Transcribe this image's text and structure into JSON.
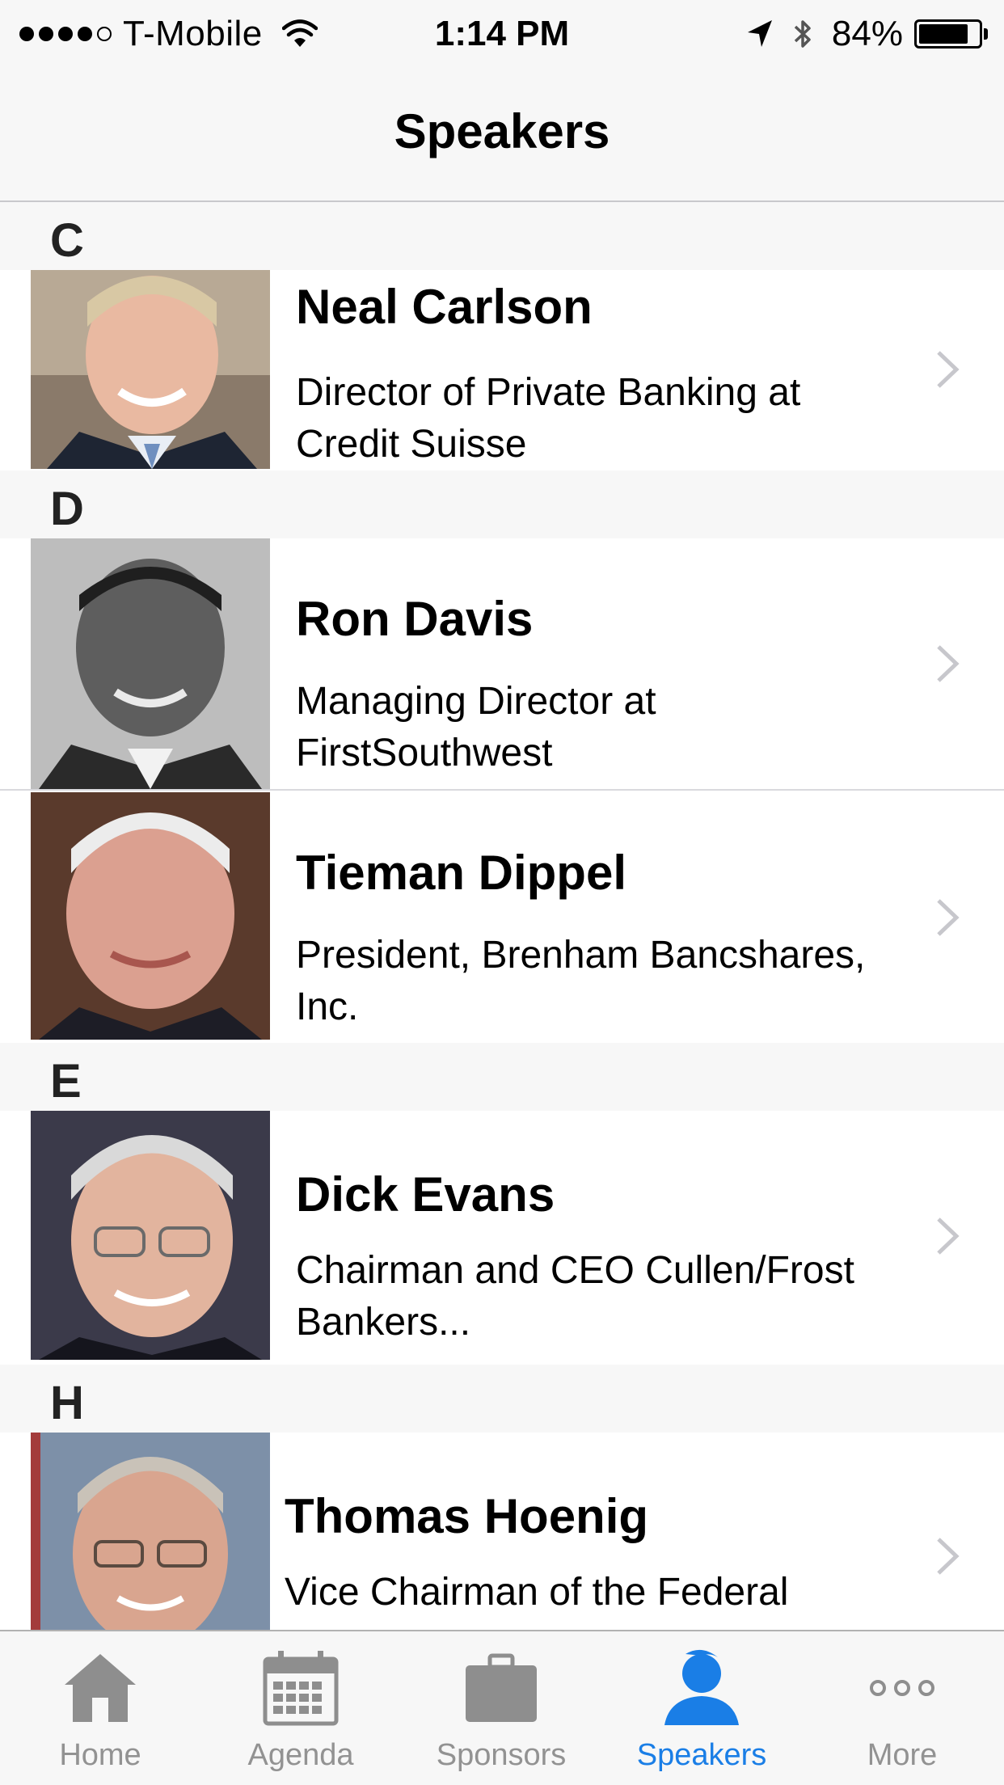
{
  "status_bar": {
    "carrier": "T-Mobile",
    "time": "1:14 PM",
    "battery": "84%",
    "battery_level": 0.84,
    "signal_bars": 4,
    "signal_total": 5
  },
  "nav": {
    "title": "Speakers"
  },
  "sections": [
    {
      "letter": "C"
    },
    {
      "letter": "D"
    },
    {
      "letter": "E"
    },
    {
      "letter": "H"
    }
  ],
  "speakers": [
    {
      "name": "Neal Carlson",
      "title": "Director of Private Banking at Credit Suisse"
    },
    {
      "name": "Ron Davis",
      "title": "Managing Director at FirstSouthwest"
    },
    {
      "name": "Tieman Dippel",
      "title": "President, Brenham Bancshares, Inc."
    },
    {
      "name": "Dick Evans",
      "title": "Chairman and CEO Cullen/Frost Bankers..."
    },
    {
      "name": "Thomas Hoenig",
      "title": "Vice Chairman of the Federal"
    }
  ],
  "tabs": [
    {
      "label": "Home",
      "icon": "home-icon"
    },
    {
      "label": "Agenda",
      "icon": "calendar-icon"
    },
    {
      "label": "Sponsors",
      "icon": "briefcase-icon"
    },
    {
      "label": "Speakers",
      "icon": "person-icon",
      "active": true
    },
    {
      "label": "More",
      "icon": "more-dots-icon"
    }
  ],
  "colors": {
    "accent": "#1a7ee6",
    "tab_inactive": "#929292",
    "bar_background": "#f7f7f7",
    "separator": "#d9d9dd"
  }
}
